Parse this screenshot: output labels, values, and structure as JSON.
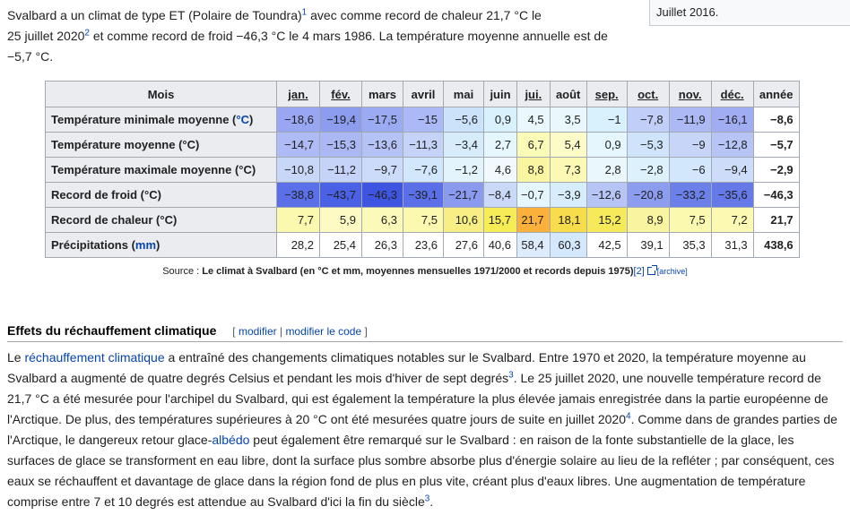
{
  "side_box_text": "Juillet 2016.",
  "intro": {
    "t1": "Svalbard a un climat de type ET (Polaire de Toundra)",
    "r1": "1",
    "t2": " avec comme record de chaleur 21,7 °C le",
    "t3": "25 juillet 2020",
    "r2": "2",
    "t4": " et comme record de froid −46,3 °C le 4 mars 1986. La température moyenne annuelle est de",
    "t5": "−5,7 °C."
  },
  "table": {
    "corner": "Mois",
    "months": [
      "jan.",
      "fév.",
      "mars",
      "avril",
      "mai",
      "juin",
      "jui.",
      "août",
      "sep.",
      "oct.",
      "nov.",
      "déc."
    ],
    "underlined": [
      true,
      true,
      false,
      false,
      false,
      false,
      true,
      false,
      true,
      true,
      true,
      true
    ],
    "year_label": "année",
    "rows": [
      {
        "label": "Température minimale moyenne (",
        "unit": "°C",
        "label_end": ")",
        "values": [
          "−18,6",
          "−19,4",
          "−17,5",
          "−15",
          "−5,6",
          "0,9",
          "4,5",
          "3,5",
          "−1",
          "−7,8",
          "−11,9",
          "−16,1"
        ],
        "colors": [
          "#99a6f2",
          "#8c9cef",
          "#9babf3",
          "#abb9f6",
          "#cbe2fb",
          "#d9f1fc",
          "#eaf8fd",
          "#eaf8fd",
          "#d9f1fc",
          "#c1cff8",
          "#adb9f4",
          "#a0adf2"
        ],
        "year": "−8,6"
      },
      {
        "label": "Température moyenne (°C)",
        "values": [
          "−14,7",
          "−15,3",
          "−13,6",
          "−11,3",
          "−3,4",
          "2,7",
          "6,7",
          "5,4",
          "0,9",
          "−5,3",
          "−9",
          "−12,8"
        ],
        "colors": [
          "#aebbf5",
          "#abb8f4",
          "#b4c2f6",
          "#c6d3f8",
          "#d6ecfb",
          "#e6f6fd",
          "#fbfbb8",
          "#fdfbc8",
          "#e6f6fd",
          "#cfe4fb",
          "#c7d6f8",
          "#b6c4f6"
        ],
        "year": "−5,7"
      },
      {
        "label": "Température maximale moyenne (°C)",
        "values": [
          "−10,8",
          "−11,2",
          "−9,7",
          "−7,6",
          "−1,2",
          "4,6",
          "8,8",
          "7,3",
          "2,8",
          "−2,8",
          "−6",
          "−9,4"
        ],
        "colors": [
          "#c8d6f8",
          "#c6d3f8",
          "#ccdbf9",
          "#d2e7fb",
          "#e3f4fd",
          "#eff9fe",
          "#f9f5a0",
          "#fbf9b4",
          "#eaf8fd",
          "#ddf1fc",
          "#d2e7fb",
          "#cddcf9"
        ],
        "year": "−2,9"
      },
      {
        "label": "Record de froid (°C)",
        "values": [
          "−38,8",
          "−43,7",
          "−46,3",
          "−39,1",
          "−21,7",
          "−8,4",
          "−0,7",
          "−3,9",
          "−12,6",
          "−20,8",
          "−33,2",
          "−35,6"
        ],
        "colors": [
          "#5b70e8",
          "#4a61e5",
          "#3e55e2",
          "#5a6fe8",
          "#8a9aef",
          "#cbd9f9",
          "#e6f6fd",
          "#d7edfb",
          "#b7c5f6",
          "#8c9cef",
          "#6c80ea",
          "#6679e9"
        ],
        "year": "−46,3"
      },
      {
        "label": "Record de chaleur (°C)",
        "values": [
          "7,7",
          "5,9",
          "6,3",
          "7,5",
          "10,6",
          "15,7",
          "21,7",
          "18,1",
          "15,2",
          "8,9",
          "7,5",
          "7,2"
        ],
        "colors": [
          "#fbf9ae",
          "#fdfbc3",
          "#fcfab9",
          "#fbf9b0",
          "#f7ee84",
          "#f6ec55",
          "#fbb03b",
          "#f7dc4c",
          "#f6ea5b",
          "#f9f49f",
          "#fbf9b0",
          "#fbf9b2"
        ],
        "year": "21,7"
      },
      {
        "label": "Précipitations (",
        "unit": "mm",
        "label_end": ")",
        "values": [
          "28,2",
          "25,4",
          "26,3",
          "23,6",
          "27,6",
          "40,6",
          "58,4",
          "60,3",
          "42,5",
          "39,1",
          "35,3",
          "31,3"
        ],
        "colors": [
          "#ffffff",
          "#ffffff",
          "#ffffff",
          "#ffffff",
          "#ffffff",
          "#ffffff",
          "#dcecfd",
          "#d4e8fd",
          "#ffffff",
          "#ffffff",
          "#ffffff",
          "#ffffff"
        ],
        "year": "438,6"
      }
    ]
  },
  "source": {
    "prefix": "Source : ",
    "title": "Le climat à Svalbard (en °C et mm, moyennes mensuelles 1971/2000 et records depuis 1975)",
    "ref": "[2]",
    "archive": "[archive]"
  },
  "section": {
    "title": "Effets du réchauffement climatique",
    "edit_open": "[ ",
    "edit1": "modifier",
    "edit_sep": " | ",
    "edit2": "modifier le code",
    "edit_close": " ]"
  },
  "para": {
    "p1": "Le ",
    "l1": "réchauffement climatique",
    "p2": " a entraîné des changements climatiques notables sur le Svalbard. Entre 1970 et 2020, la température moyenne au Svalbard a augmenté de quatre degrés Celsius et pendant les mois d'hiver de sept degrés",
    "r3": "3",
    "p3": ". Le 25 juillet 2020, une nouvelle température record de 21,7 °C a été mesurée pour l'archipel du Svalbard, qui est également la température la plus élevée jamais enregistrée dans la partie européenne de l'Arctique. De plus, des températures supérieures à 20 °C ont été mesurées quatre jours de suite en juillet 2020",
    "r4": "4",
    "p4": ". Comme dans de grandes parties de l'Arctique, le dangereux retour glace-",
    "l2": "albédo",
    "p5": " peut également être remarqué sur le Svalbard : en raison de la fonte substantielle de la glace, les surfaces de glace se transforment en eau libre, dont la surface plus sombre absorbe plus d'énergie solaire au lieu de la refléter ; par conséquent, ces eaux se réchauffent et davantage de glace dans la région fond de plus en plus vite, créant plus d'eaux libres. Une augmentation de température comprise entre 7 et 10 degrés est attendue au Svalbard d'ici la fin du siècle",
    "r5": "3",
    "p6": "."
  }
}
